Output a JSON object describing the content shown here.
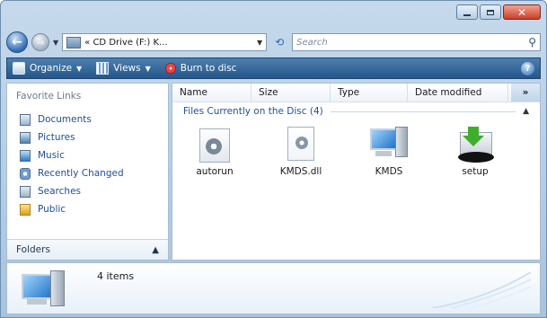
{
  "window": {
    "caption_buttons": [
      "minimize",
      "maximize",
      "close"
    ]
  },
  "address_bar": {
    "path": "« CD Drive (F:) K...",
    "search_placeholder": "Search"
  },
  "toolbar": {
    "organize_label": "Organize",
    "views_label": "Views",
    "burn_label": "Burn to disc"
  },
  "nav_pane": {
    "favorite_links_title": "Favorite Links",
    "links": [
      {
        "label": "Documents",
        "icon": "documents-icon"
      },
      {
        "label": "Pictures",
        "icon": "pictures-icon"
      },
      {
        "label": "Music",
        "icon": "music-icon"
      },
      {
        "label": "Recently Changed",
        "icon": "recently-changed-icon"
      },
      {
        "label": "Searches",
        "icon": "searches-icon"
      },
      {
        "label": "Public",
        "icon": "public-icon"
      }
    ],
    "folders_label": "Folders"
  },
  "content": {
    "columns": [
      "Name",
      "Size",
      "Type",
      "Date modified"
    ],
    "more_columns_glyph": "»",
    "group_header": "Files Currently on the Disc (4)",
    "files": [
      {
        "name": "autorun",
        "icon": "settings-file-icon"
      },
      {
        "name": "KMDS.dll",
        "icon": "dll-file-icon"
      },
      {
        "name": "KMDS",
        "icon": "application-computer-icon"
      },
      {
        "name": "setup",
        "icon": "setup-install-icon"
      }
    ]
  },
  "details_pane": {
    "item_count": "4 items"
  }
}
